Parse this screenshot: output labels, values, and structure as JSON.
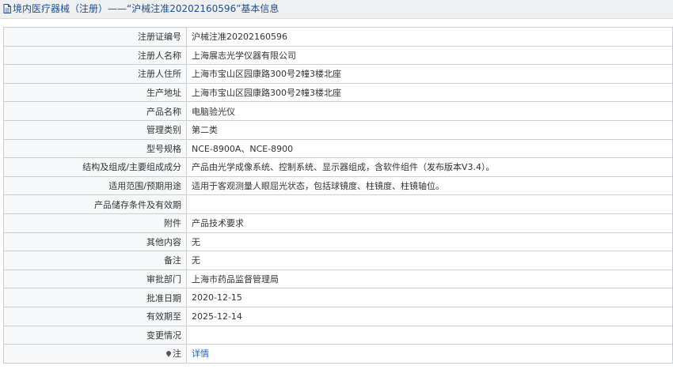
{
  "header": {
    "title": "境内医疗器械（注册）——“沪械注准20202160596”基本信息"
  },
  "rows": [
    {
      "label": "注册证编号",
      "value": "沪械注准20202160596"
    },
    {
      "label": "注册人名称",
      "value": "上海展志光学仪器有限公司"
    },
    {
      "label": "注册人住所",
      "value": "上海市宝山区园康路300号2幢3楼北座"
    },
    {
      "label": "生产地址",
      "value": "上海市宝山区园康路300号2幢3楼北座"
    },
    {
      "label": "产品名称",
      "value": "电脑验光仪"
    },
    {
      "label": "管理类别",
      "value": "第二类"
    },
    {
      "label": "型号规格",
      "value": "NCE-8900A、NCE-8900"
    },
    {
      "label": "结构及组成/主要组成成分",
      "value": "产品由光学成像系统、控制系统、显示器组成，含软件组件（发布版本V3.4）。"
    },
    {
      "label": "适用范围/预期用途",
      "value": "适用于客观测量人眼屈光状态，包括球镜度、柱镜度、柱镜轴位。"
    },
    {
      "label": "产品储存条件及有效期",
      "value": ""
    },
    {
      "label": "附件",
      "value": "产品技术要求"
    },
    {
      "label": "其他内容",
      "value": "无"
    },
    {
      "label": "备注",
      "value": "无"
    },
    {
      "label": "审批部门",
      "value": "上海市药品监督管理局"
    },
    {
      "label": "批准日期",
      "value": "2020-12-15"
    },
    {
      "label": "有效期至",
      "value": "2025-12-14"
    },
    {
      "label": "变更情况",
      "value": ""
    }
  ],
  "note_row": {
    "label": "注",
    "link": "详情"
  },
  "colors": {
    "header_bg": "#eef0f2",
    "title": "#1f4e8c",
    "border": "#c9ced4",
    "link": "#1f5fbf"
  }
}
